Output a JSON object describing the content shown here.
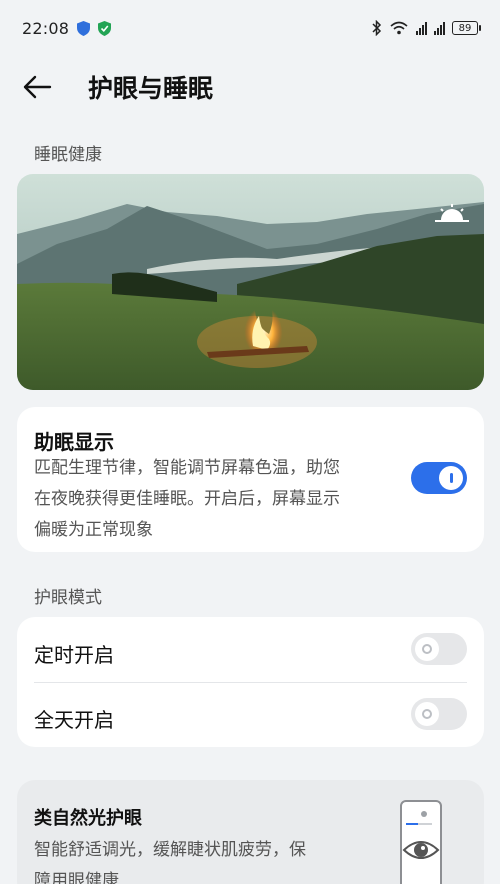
{
  "status_bar": {
    "time": "22:08",
    "battery": "89"
  },
  "header": {
    "title": "护眼与睡眠"
  },
  "sleep_section": {
    "label": "睡眠健康"
  },
  "sleep_display": {
    "title": "助眠显示",
    "description_lines": [
      "匹配生理节律，智能调节屏幕色温，助您",
      "在夜晚获得更佳睡眠。开启后，屏幕显示",
      "偏暖为正常现象"
    ],
    "enabled": true
  },
  "eye_mode_section": {
    "label": "护眼模式",
    "rows": [
      {
        "label": "定时开启",
        "enabled": false
      },
      {
        "label": "全天开启",
        "enabled": false
      }
    ]
  },
  "natural_light": {
    "title": "类自然光护眼",
    "description_lines": [
      "智能舒适调光，缓解睫状肌疲劳，保",
      "障用眼健康"
    ]
  },
  "colors": {
    "accent": "#2c6fea",
    "background": "#f1f3f5"
  }
}
